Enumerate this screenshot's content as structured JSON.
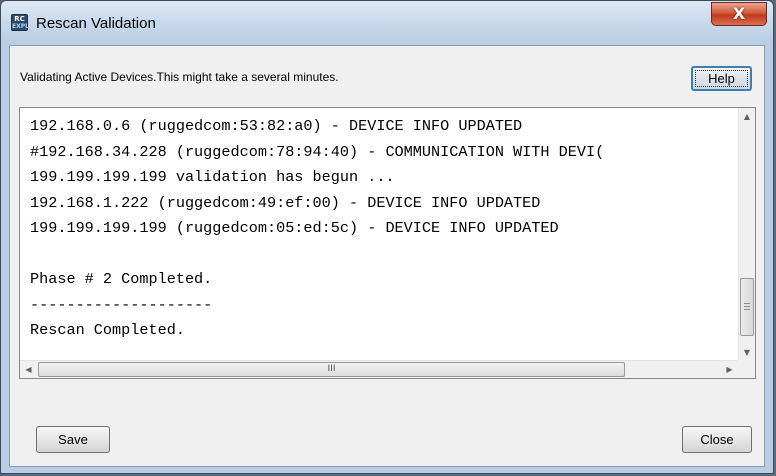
{
  "window": {
    "title": "Rescan Validation",
    "app_icon": {
      "line1": "RC",
      "line2": "EXPL"
    },
    "close_glyph": "X"
  },
  "message": "Validating Active Devices.This might take a several minutes.",
  "buttons": {
    "help": "Help",
    "save": "Save",
    "close": "Close"
  },
  "log": {
    "lines": [
      "192.168.0.6 (ruggedcom:53:82:a0) - DEVICE INFO UPDATED",
      "#192.168.34.228 (ruggedcom:78:94:40) - COMMUNICATION WITH DEVI(",
      "199.199.199.199 validation has begun ...",
      "192.168.1.222 (ruggedcom:49:ef:00) - DEVICE INFO UPDATED",
      "199.199.199.199 (ruggedcom:05:ed:5c) - DEVICE INFO UPDATED",
      "",
      "Phase # 2 Completed.",
      "--------------------",
      "Rescan Completed."
    ]
  },
  "scrollbars": {
    "up_glyph": "▲",
    "down_glyph": "▼",
    "left_glyph": "◀",
    "right_glyph": "▶",
    "hthumb_grip": "III"
  }
}
